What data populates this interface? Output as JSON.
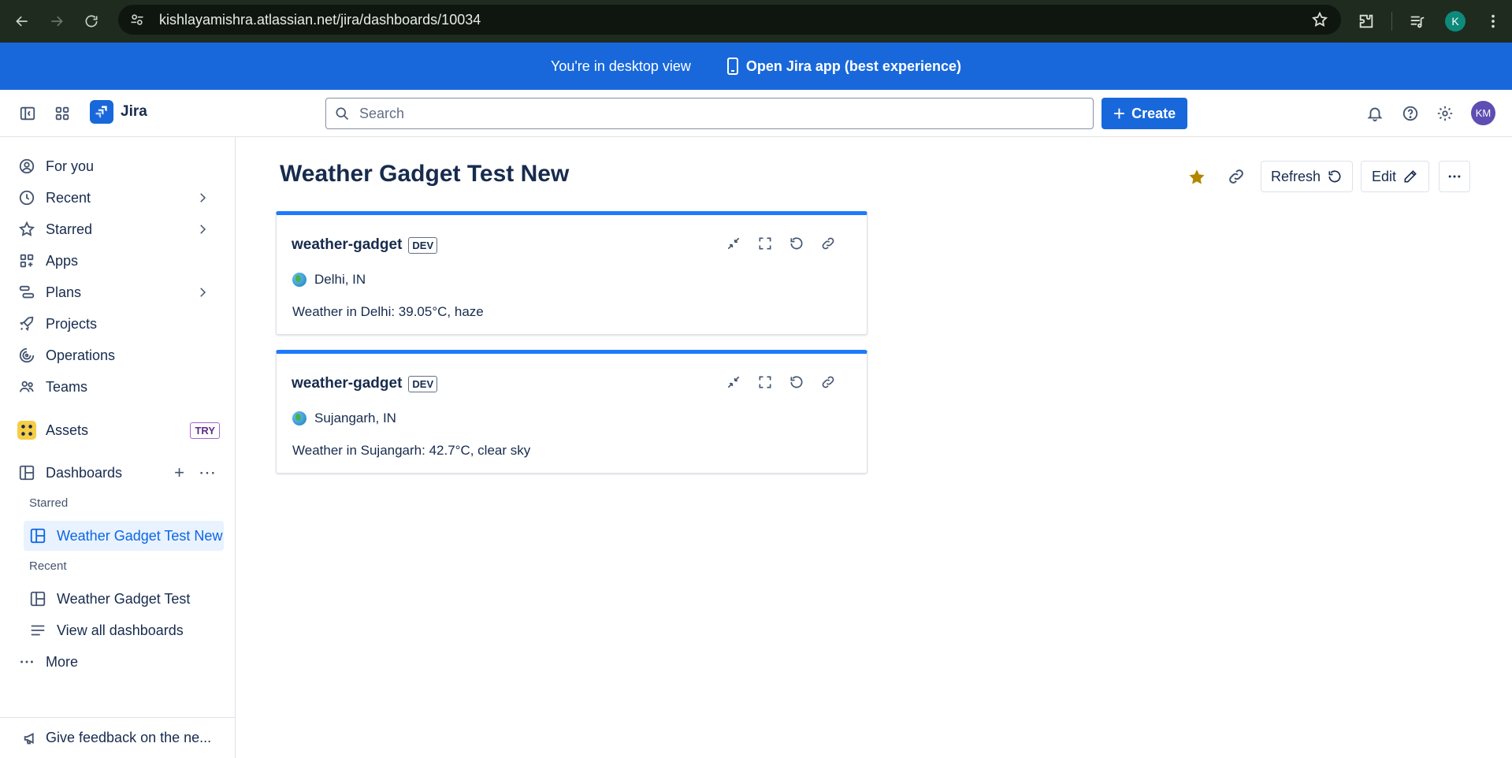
{
  "browser": {
    "url": "kishlayamishra.atlassian.net/jira/dashboards/10034",
    "profile_initial": "K"
  },
  "banner": {
    "desktop_view_text": "You're in desktop view",
    "open_app_text": "Open Jira app (best experience)"
  },
  "topnav": {
    "product_name": "Jira",
    "search_placeholder": "Search",
    "create_label": "Create",
    "user_initials": "KM"
  },
  "sidebar": {
    "items": [
      {
        "label": "For you",
        "icon": "person-circle-icon"
      },
      {
        "label": "Recent",
        "icon": "clock-icon"
      },
      {
        "label": "Starred",
        "icon": "star-icon"
      },
      {
        "label": "Apps",
        "icon": "apps-icon"
      },
      {
        "label": "Plans",
        "icon": "plans-icon"
      },
      {
        "label": "Projects",
        "icon": "rocket-icon"
      },
      {
        "label": "Operations",
        "icon": "operations-icon"
      },
      {
        "label": "Teams",
        "icon": "teams-icon"
      }
    ],
    "assets_label": "Assets",
    "try_badge": "TRY",
    "dashboards_label": "Dashboards",
    "starred_section": "Starred",
    "starred_dashboard": "Weather Gadget Test New",
    "recent_section": "Recent",
    "recent_dashboard": "Weather Gadget Test",
    "view_all": "View all dashboards",
    "more": "More",
    "feedback": "Give feedback on the ne..."
  },
  "main": {
    "title": "Weather Gadget Test New",
    "refresh_label": "Refresh",
    "edit_label": "Edit",
    "starred_color": "#b38600"
  },
  "gadgets": [
    {
      "title": "weather-gadget",
      "badge": "DEV",
      "location": "Delhi, IN",
      "weather": "Weather in Delhi: 39.05°C, haze"
    },
    {
      "title": "weather-gadget",
      "badge": "DEV",
      "location": "Sujangarh, IN",
      "weather": "Weather in Sujangarh: 42.7°C, clear sky"
    }
  ],
  "colors": {
    "brand_blue": "#1868db",
    "gadget_accent": "#1d7afc"
  }
}
